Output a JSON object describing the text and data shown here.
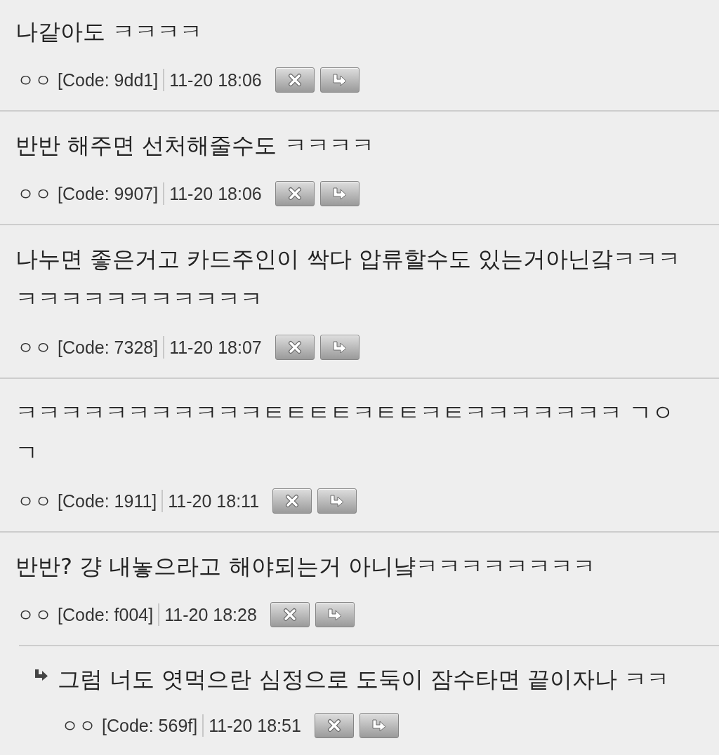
{
  "comments": [
    {
      "kind": "comment",
      "text": "나같아도 ㅋㅋㅋㅋ",
      "nickname": "ㅇㅇ",
      "code": "[Code: 9dd1]",
      "time": "11-20 18:06"
    },
    {
      "kind": "comment",
      "text": "반반 해주면 선처해줄수도 ㅋㅋㅋㅋ",
      "nickname": "ㅇㅇ",
      "code": "[Code: 9907]",
      "time": "11-20 18:06"
    },
    {
      "kind": "comment",
      "text": "나누면 좋은거고 카드주인이 싹다 압류할수도 있는거아닌갘ㅋㅋㅋㅋㅋㅋㅋㅋㅋㅋㅋㅋㅋㅋ",
      "nickname": "ㅇㅇ",
      "code": "[Code: 7328]",
      "time": "11-20 18:07"
    },
    {
      "kind": "comment",
      "text": "ㅋㅋㅋㅋㅋㅋㅋㅋㅋㅋㅋㅌㅌㅌㅌㅋㅌㅌㅋㅌㅋㅋㅋㅋㅋㅋㅋ ㄱㅇㄱ",
      "nickname": "ㅇㅇ",
      "code": "[Code: 1911]",
      "time": "11-20 18:11"
    },
    {
      "kind": "comment",
      "text": "반반? 걍 내놓으라고 해야되는거 아니냨ㅋㅋㅋㅋㅋㅋㅋㅋ",
      "nickname": "ㅇㅇ",
      "code": "[Code: f004]",
      "time": "11-20 18:28",
      "children": [
        {
          "kind": "reply",
          "text": "그럼 너도 엿먹으란 심정으로 도둑이 잠수타면 끝이자나 ㅋㅋ",
          "nickname": "ㅇㅇ",
          "code": "[Code: 569f]",
          "time": "11-20 18:51"
        }
      ]
    }
  ]
}
